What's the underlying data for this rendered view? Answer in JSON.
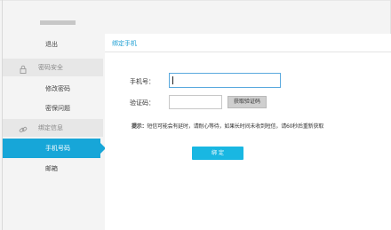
{
  "sidebar": {
    "logout_label": "退出",
    "section_security": {
      "label": "密码安全",
      "icon": "lock-icon"
    },
    "item_change_password": "修改密码",
    "item_security_question": "密保问题",
    "section_binding": {
      "label": "绑定信息",
      "icon": "link-icon"
    },
    "item_phone": "手机号码",
    "item_email": "邮箱"
  },
  "main": {
    "title": "绑定手机",
    "phone_label": "手机号：",
    "phone_value": "",
    "code_label": "验证码：",
    "code_value": "",
    "get_code_button": "获取验证码",
    "hint_prefix": "提示：",
    "hint_text": "短信可能会有延时，请耐心等待，如果长时间未收到短信，请60秒后重新获取",
    "bind_button": "绑 定"
  },
  "colors": {
    "accent": "#17a6d8",
    "title_blue": "#1f9fd3",
    "button_blue": "#19b7e2"
  }
}
